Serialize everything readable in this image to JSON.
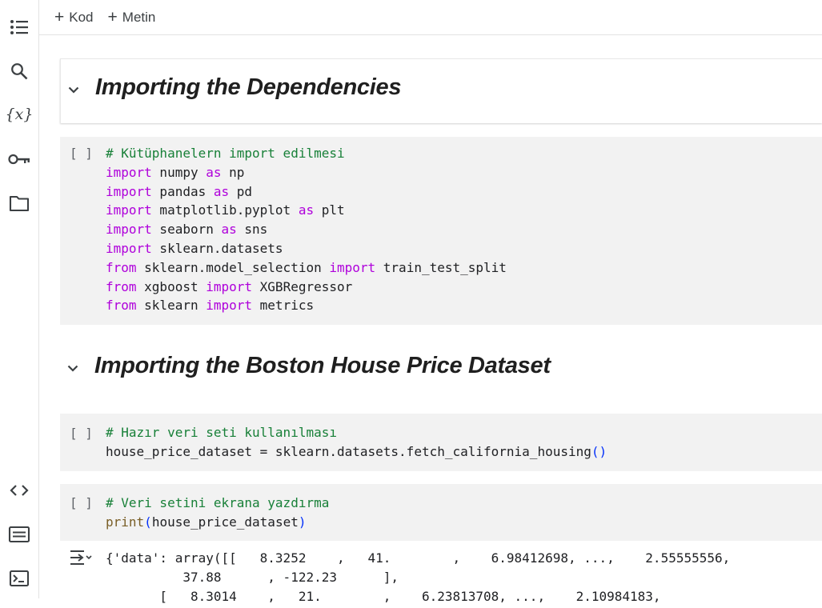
{
  "toolbar": {
    "add_code_label": "Kod",
    "add_text_label": "Metin"
  },
  "sidebar": {
    "variables_glyph": "{x}"
  },
  "cells": {
    "heading1": {
      "title": "Importing the Dependencies"
    },
    "code1": {
      "indicator": "[ ]",
      "comment": "# Kütüphanelern import edilmesi",
      "lines": [
        {
          "kw1": "import",
          "mod": " numpy ",
          "kw2": "as",
          "alias": " np"
        },
        {
          "kw1": "import",
          "mod": " pandas ",
          "kw2": "as",
          "alias": " pd"
        },
        {
          "kw1": "import",
          "mod": " matplotlib.pyplot ",
          "kw2": "as",
          "alias": " plt"
        },
        {
          "kw1": "import",
          "mod": " seaborn ",
          "kw2": "as",
          "alias": " sns"
        },
        {
          "kw1": "import",
          "mod": " sklearn.datasets",
          "kw2": "",
          "alias": ""
        },
        {
          "kw1": "from",
          "mod": " sklearn.model_selection ",
          "kw2": "import",
          "alias": " train_test_split"
        },
        {
          "kw1": "from",
          "mod": " xgboost ",
          "kw2": "import",
          "alias": " XGBRegressor"
        },
        {
          "kw1": "from",
          "mod": " sklearn ",
          "kw2": "import",
          "alias": " metrics"
        }
      ]
    },
    "heading2": {
      "title": "Importing the Boston House Price Dataset"
    },
    "code2": {
      "indicator": "[ ]",
      "comment": "# Hazır veri seti kullanılması",
      "stmt": "house_price_dataset = sklearn.datasets.fetch_california_housing",
      "open_paren": "(",
      "close_paren": ")"
    },
    "code3": {
      "indicator": "[ ]",
      "comment": "# Veri setini ekrana yazdırma",
      "fn": "print",
      "open_paren": "(",
      "arg": "house_price_dataset",
      "close_paren": ")"
    },
    "output3": {
      "lines": [
        "{'data': array([[   8.3252    ,   41.        ,    6.98412698, ...,    2.55555556,",
        "          37.88      , -122.23      ],",
        "       [   8.3014    ,   21.        ,    6.23813708, ...,    2.10984183,"
      ]
    }
  },
  "colors": {
    "comment": "#188038",
    "keyword": "#af00db",
    "function": "#795e26",
    "paren": "#0431fa",
    "cell_bg": "#f2f2f2"
  },
  "icons": [
    "toc-icon",
    "search-icon",
    "variables-icon",
    "key-icon",
    "folder-icon",
    "code-snippets-icon",
    "command-palette-icon",
    "terminal-icon",
    "chevron-down-icon",
    "output-collapse-icon"
  ]
}
